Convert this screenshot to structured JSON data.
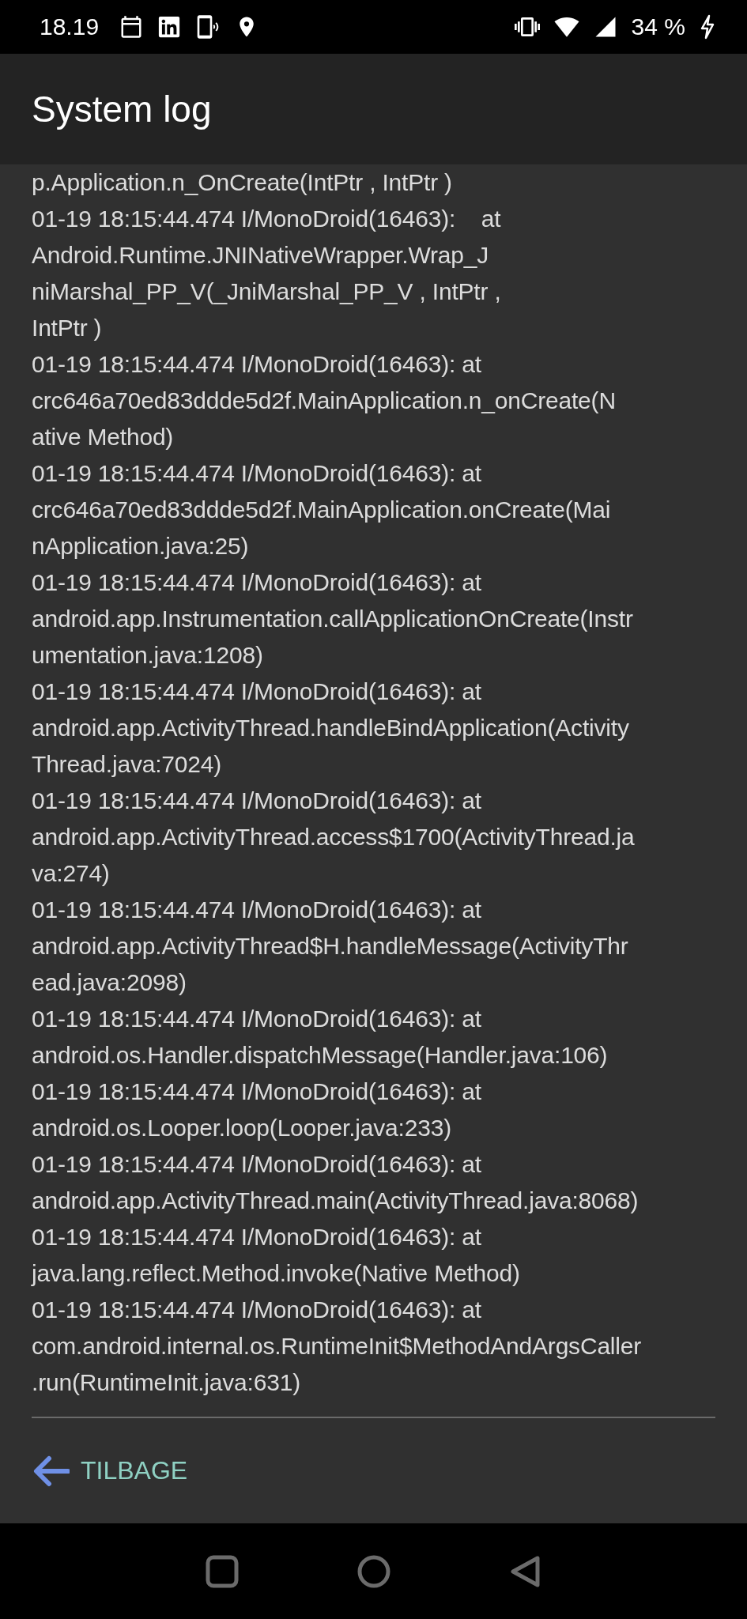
{
  "status_bar": {
    "time": "18.19",
    "battery": "34 %"
  },
  "app_bar": {
    "title": "System log"
  },
  "log_lines": [
    "p.Application.n_OnCreate(IntPtr , IntPtr )",
    "01-19 18:15:44.474 I/MonoDroid(16463):    at",
    "Android.Runtime.JNINativeWrapper.Wrap_J",
    "niMarshal_PP_V(_JniMarshal_PP_V , IntPtr ,",
    "IntPtr )",
    "01-19 18:15:44.474 I/MonoDroid(16463): at",
    "crc646a70ed83ddde5d2f.MainApplication.n_onCreate(N",
    "ative Method)",
    "01-19 18:15:44.474 I/MonoDroid(16463): at",
    "crc646a70ed83ddde5d2f.MainApplication.onCreate(Mai",
    "nApplication.java:25)",
    "01-19 18:15:44.474 I/MonoDroid(16463): at",
    "android.app.Instrumentation.callApplicationOnCreate(Instr",
    "umentation.java:1208)",
    "01-19 18:15:44.474 I/MonoDroid(16463): at",
    "android.app.ActivityThread.handleBindApplication(Activity",
    "Thread.java:7024)",
    "01-19 18:15:44.474 I/MonoDroid(16463): at",
    "android.app.ActivityThread.access$1700(ActivityThread.ja",
    "va:274)",
    "01-19 18:15:44.474 I/MonoDroid(16463): at",
    "android.app.ActivityThread$H.handleMessage(ActivityThr",
    "ead.java:2098)",
    "01-19 18:15:44.474 I/MonoDroid(16463): at",
    "android.os.Handler.dispatchMessage(Handler.java:106)",
    "01-19 18:15:44.474 I/MonoDroid(16463): at",
    "android.os.Looper.loop(Looper.java:233)",
    "01-19 18:15:44.474 I/MonoDroid(16463): at",
    "android.app.ActivityThread.main(ActivityThread.java:8068)",
    "01-19 18:15:44.474 I/MonoDroid(16463): at",
    "java.lang.reflect.Method.invoke(Native Method)",
    "01-19 18:15:44.474 I/MonoDroid(16463): at",
    "com.android.internal.os.RuntimeInit$MethodAndArgsCaller",
    ".run(RuntimeInit.java:631)"
  ],
  "back_button": {
    "label": "TILBAGE"
  }
}
